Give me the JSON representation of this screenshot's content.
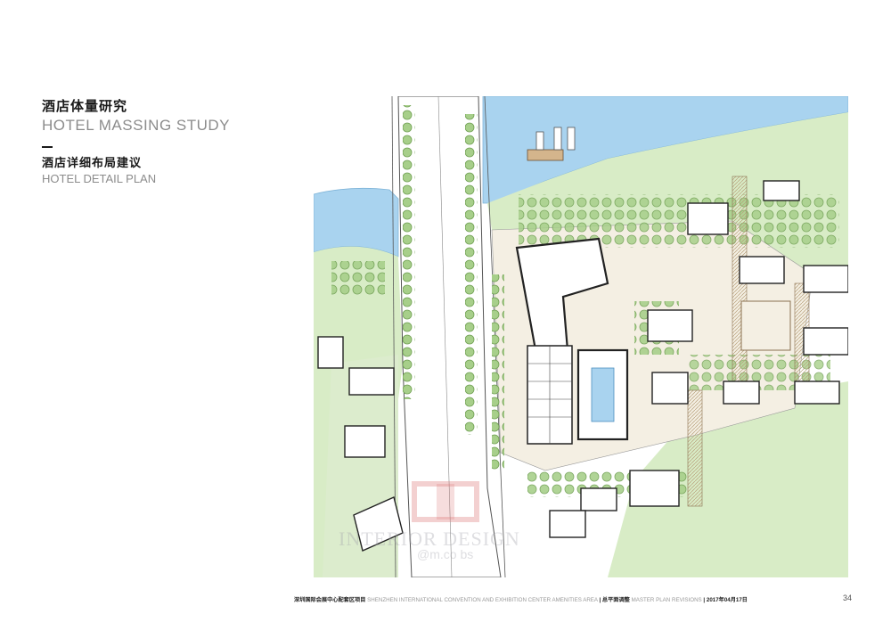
{
  "header": {
    "title_zh": "酒店体量研究",
    "title_en": "HOTEL MASSING STUDY",
    "subtitle_zh": "酒店详细布局建议",
    "subtitle_en": "HOTEL DETAIL PLAN"
  },
  "footer": {
    "project_zh": "深圳国际会展中心配套区项目",
    "project_en": "SHENZHEN INTERNATIONAL CONVENTION AND EXHIBITION CENTER AMENITIES AREA",
    "section_zh": "总平面调整",
    "section_en": "MASTER PLAN REVISIONS",
    "date": "2017年04月17日",
    "page_number": "34"
  },
  "watermark": {
    "text": "INTERIOR DESIGN",
    "sub": "@m.co bs"
  },
  "colors": {
    "water": "#a9d3ef",
    "grass": "#d8ecc6",
    "tree": "#8cbf6c",
    "building_outline": "#222222",
    "plaza": "#e8ddc9"
  }
}
